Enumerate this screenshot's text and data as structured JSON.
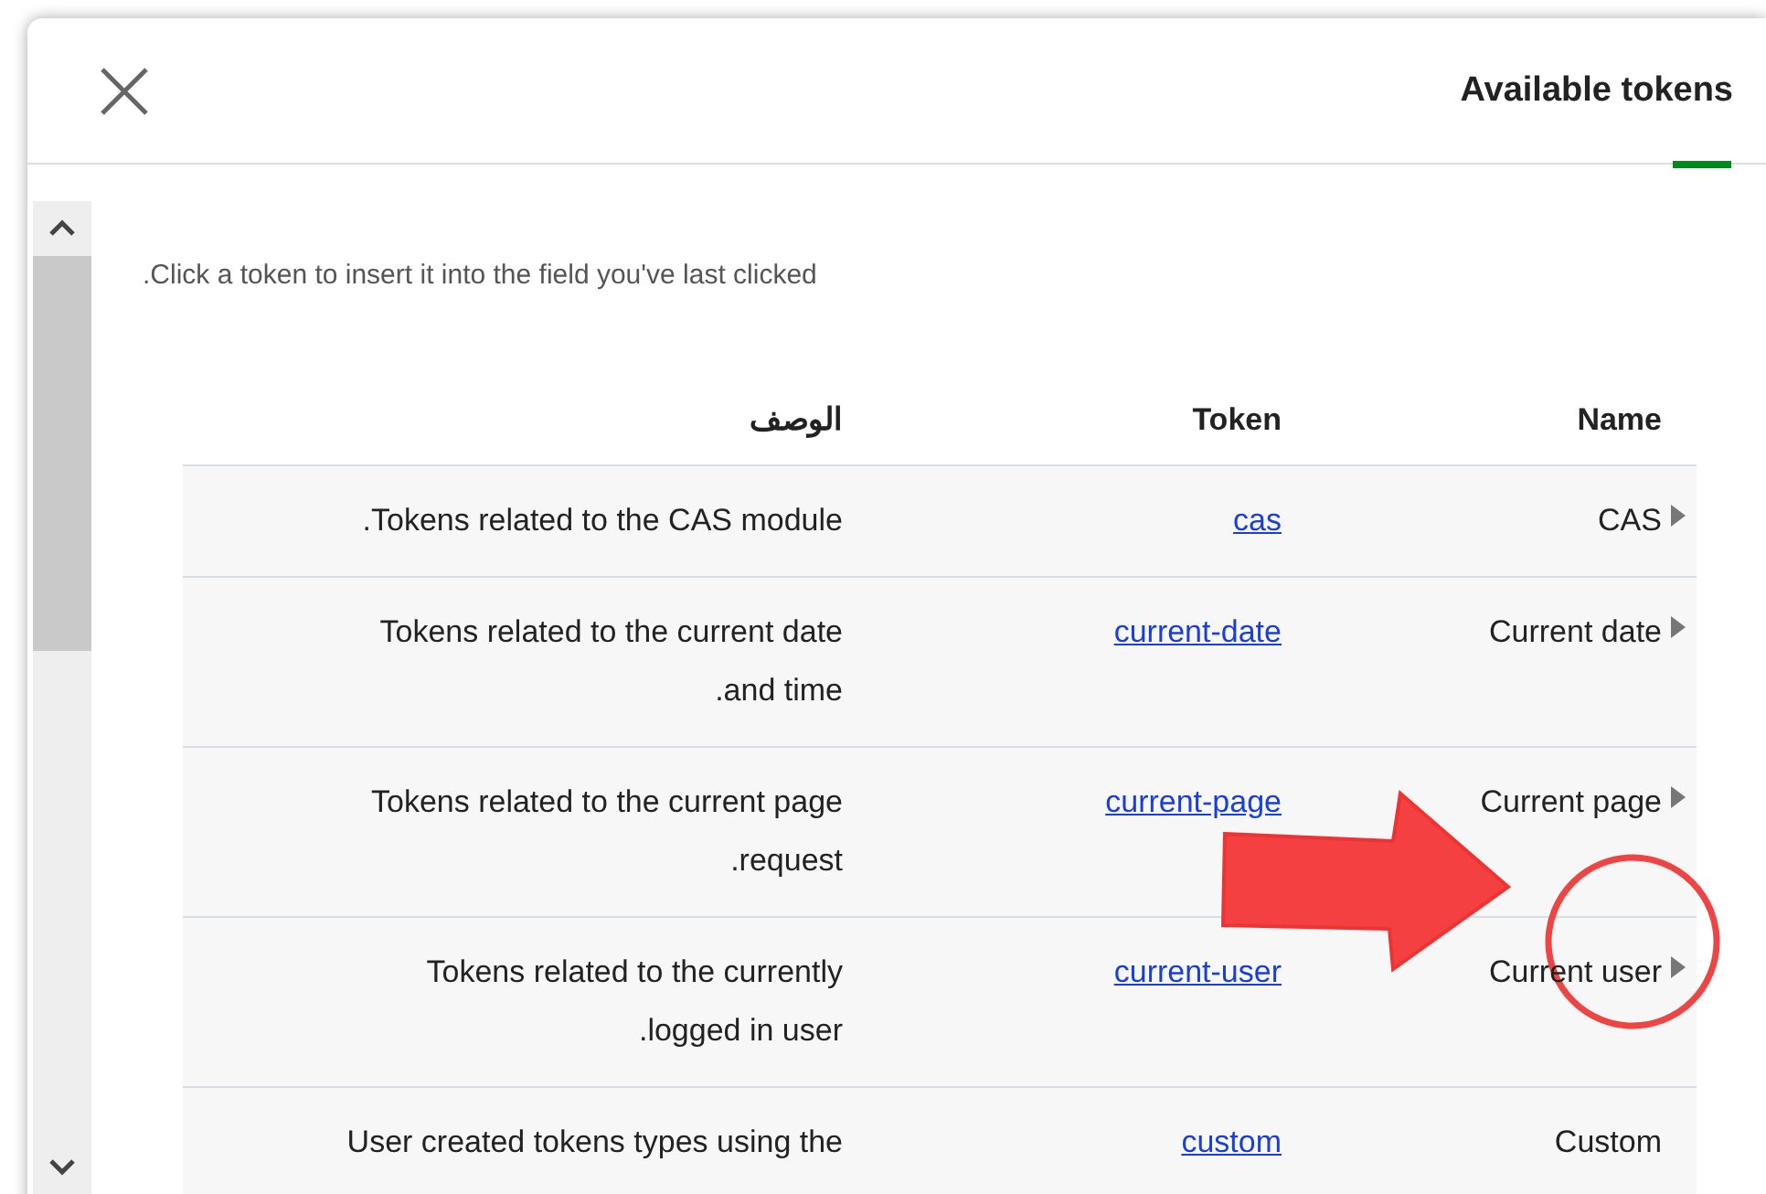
{
  "dialog": {
    "title": "Available tokens",
    "tab_selected": true
  },
  "intro": "Click a token to insert it into the field you've last clicked.",
  "table": {
    "columns": [
      "الوصف",
      "Token",
      "Name"
    ],
    "rows": [
      {
        "description": "Tokens related to the CAS module.",
        "token": "cas",
        "name": "CAS",
        "expandable": true
      },
      {
        "description": "Tokens related to the current date and time.",
        "token": "current-date",
        "name": "Current date",
        "expandable": true
      },
      {
        "description": "Tokens related to the current page request.",
        "token": "current-page",
        "name": "Current page",
        "expandable": true
      },
      {
        "description": "Tokens related to the currently logged in user.",
        "token": "current-user",
        "name": "Current user",
        "expandable": true
      },
      {
        "description": "User created tokens types using the",
        "token": "custom",
        "name": "Custom",
        "expandable": false
      }
    ]
  }
}
